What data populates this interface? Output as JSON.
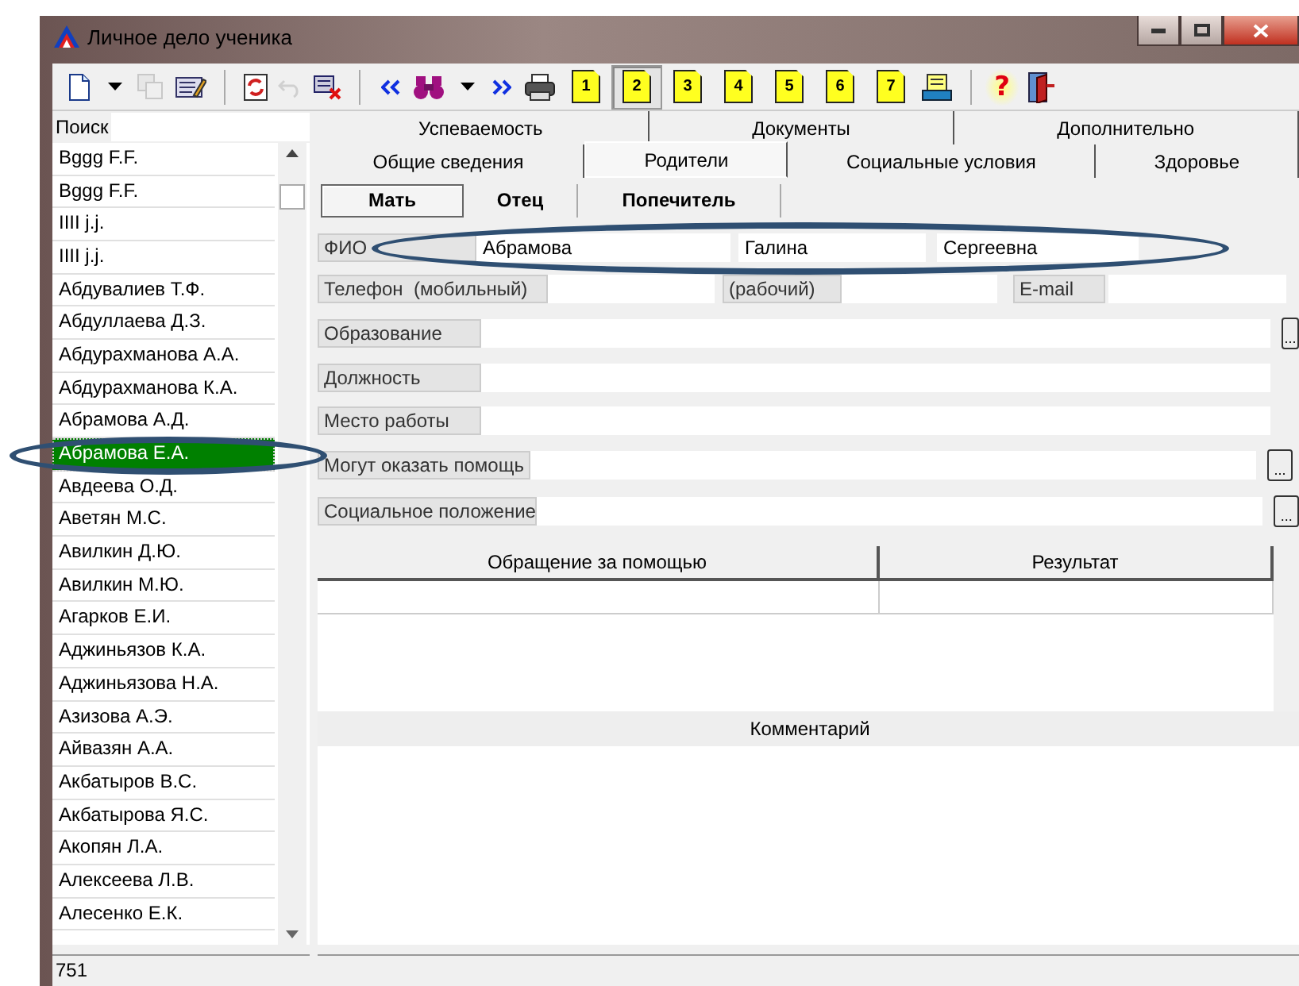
{
  "window": {
    "title": "Личное дело ученика"
  },
  "toolbar": [
    {
      "kind": "new"
    },
    {
      "kind": "caret"
    },
    {
      "kind": "copy",
      "disabled": true
    },
    {
      "kind": "edit"
    },
    {
      "kind": "sep"
    },
    {
      "kind": "refresh"
    },
    {
      "kind": "undo",
      "disabled": true
    },
    {
      "kind": "delete"
    },
    {
      "kind": "sep"
    },
    {
      "kind": "prev"
    },
    {
      "kind": "find"
    },
    {
      "kind": "caret"
    },
    {
      "kind": "next"
    },
    {
      "kind": "print"
    },
    {
      "kind": "page",
      "label": "1",
      "selected": false
    },
    {
      "kind": "page",
      "label": "2",
      "selected": true
    },
    {
      "kind": "page",
      "label": "3",
      "selected": false
    },
    {
      "kind": "page",
      "label": "4",
      "selected": false
    },
    {
      "kind": "page",
      "label": "5",
      "selected": false
    },
    {
      "kind": "page",
      "label": "6",
      "selected": false
    },
    {
      "kind": "page",
      "label": "7",
      "selected": false
    },
    {
      "kind": "report"
    },
    {
      "kind": "sep"
    },
    {
      "kind": "help",
      "label": "?"
    },
    {
      "kind": "exit"
    }
  ],
  "sidebar": {
    "search_label": "Поиск",
    "circled_selected": true,
    "items": [
      {
        "name": "Bggg F.F.",
        "selected": false
      },
      {
        "name": "Bggg F.F.",
        "selected": false
      },
      {
        "name": "IIII j.j.",
        "selected": false
      },
      {
        "name": "IIII j.j.",
        "selected": false
      },
      {
        "name": "Абдувалиев Т.Ф.",
        "selected": false
      },
      {
        "name": "Абдуллаева Д.З.",
        "selected": false
      },
      {
        "name": "Абдурахманова А.А.",
        "selected": false
      },
      {
        "name": "Абдурахманова К.А.",
        "selected": false
      },
      {
        "name": "Абрамова А.Д.",
        "selected": false
      },
      {
        "name": "Абрамова Е.А.",
        "selected": true
      },
      {
        "name": "Авдеева О.Д.",
        "selected": false
      },
      {
        "name": "Аветян М.С.",
        "selected": false
      },
      {
        "name": "Авилкин Д.Ю.",
        "selected": false
      },
      {
        "name": "Авилкин М.Ю.",
        "selected": false
      },
      {
        "name": "Агарков Е.И.",
        "selected": false
      },
      {
        "name": "Аджиньязов К.А.",
        "selected": false
      },
      {
        "name": "Аджиньязова Н.А.",
        "selected": false
      },
      {
        "name": "Азизова А.Э.",
        "selected": false
      },
      {
        "name": "Айвазян А.А.",
        "selected": false
      },
      {
        "name": "Акбатыров В.С.",
        "selected": false
      },
      {
        "name": "Акбатырова Я.С.",
        "selected": false
      },
      {
        "name": "Акопян Л.А.",
        "selected": false
      },
      {
        "name": "Алексеева Л.В.",
        "selected": false
      },
      {
        "name": "Алесенко Е.К.",
        "selected": false
      }
    ]
  },
  "tabs_row_1": [
    {
      "label": "Успеваемость",
      "selected": false
    },
    {
      "label": "Документы",
      "selected": false
    },
    {
      "label": "Дополнительно",
      "selected": false
    }
  ],
  "tabs_row_2": [
    {
      "label": "Общие сведения",
      "selected": false
    },
    {
      "label": "Родители",
      "selected": true
    },
    {
      "label": "Социальные условия",
      "selected": false
    },
    {
      "label": "Здоровье",
      "selected": false
    }
  ],
  "subtabs": [
    {
      "label": "Мать",
      "selected": true
    },
    {
      "label": "Отец",
      "selected": false
    },
    {
      "label": "Попечитель",
      "selected": false
    }
  ],
  "form": {
    "fio": {
      "label": "ФИО",
      "circled": true,
      "values": [
        "Абрамова",
        "Галина",
        "Сергеевна"
      ]
    },
    "phone": {
      "label": "Телефон  (мобильный)",
      "work_label": "(рабочий)",
      "email_label": "E-mail"
    },
    "rows": [
      {
        "label": "Образование",
        "button": "..."
      },
      {
        "label": "Должность"
      },
      {
        "label": "Место работы"
      },
      {
        "label": "Могут оказать помощь",
        "button": "..."
      },
      {
        "label": "Социальное положение",
        "button": "..."
      }
    ]
  },
  "table": {
    "columns": [
      "Обращение за помощью",
      "Результат"
    ]
  },
  "comment": {
    "label": "Комментарий"
  },
  "status_bar": {
    "count": "751"
  }
}
